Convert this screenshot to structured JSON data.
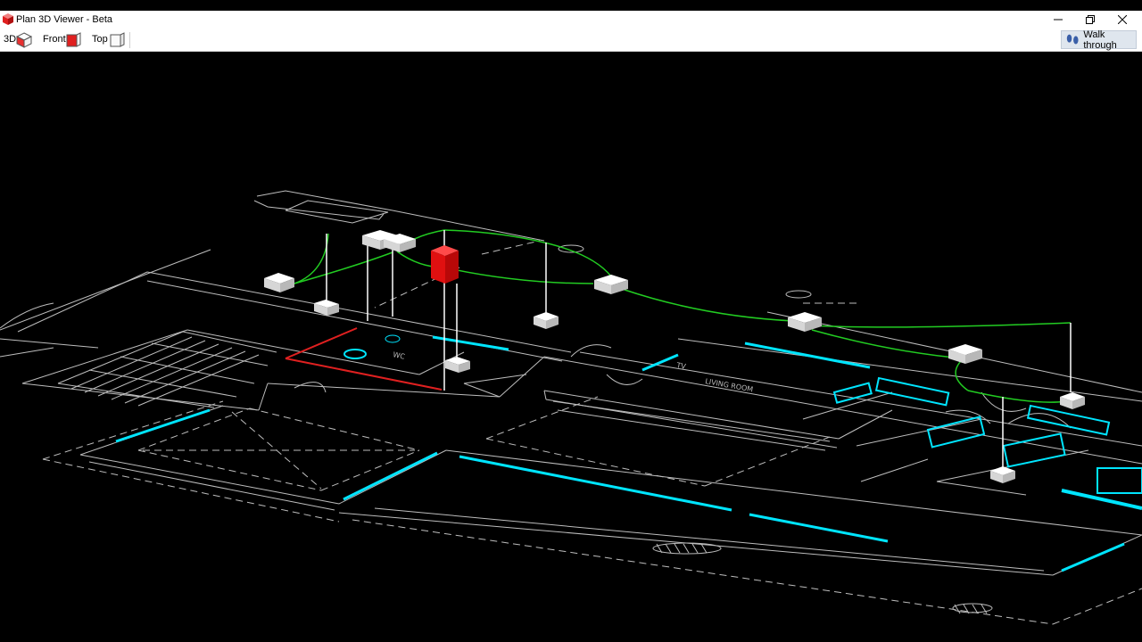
{
  "window": {
    "title": "Plan 3D Viewer - Beta",
    "icon": "app-cube-icon"
  },
  "toolbar": {
    "view_3d_label": "3D",
    "view_front_label": "Front",
    "view_top_label": "Top",
    "walk_through_label": "Walk through"
  },
  "plan_labels": {
    "room_left": "WC",
    "room_right": "LIVING ROOM",
    "tv_label": "TV"
  },
  "colors": {
    "plan_lines": "#bdbdbd",
    "fixtures": "#00e5ff",
    "wiring": "#22cc22",
    "selected_device": "#ff1a1a",
    "devices": "#ffffff"
  }
}
